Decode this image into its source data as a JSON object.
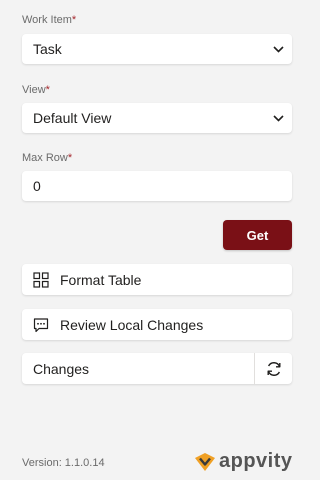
{
  "form": {
    "work_item": {
      "label": "Work Item",
      "required_mark": "*",
      "value": "Task"
    },
    "view": {
      "label": "View",
      "required_mark": "*",
      "value": "Default View"
    },
    "max_row": {
      "label": "Max Row",
      "required_mark": "*",
      "value": "0"
    },
    "get_label": "Get"
  },
  "actions": {
    "format_table": {
      "label": "Format Table",
      "icon": "grid-icon"
    },
    "review_changes": {
      "label": "Review Local Changes",
      "icon": "comment-icon"
    }
  },
  "changes": {
    "label": "Changes",
    "icon": "refresh-icon"
  },
  "footer": {
    "version": "Version: 1.1.0.14",
    "logo_text": "appvity"
  },
  "colors": {
    "accent": "#7a1016",
    "required": "#a4262c",
    "logo_orange": "#f0a024"
  }
}
